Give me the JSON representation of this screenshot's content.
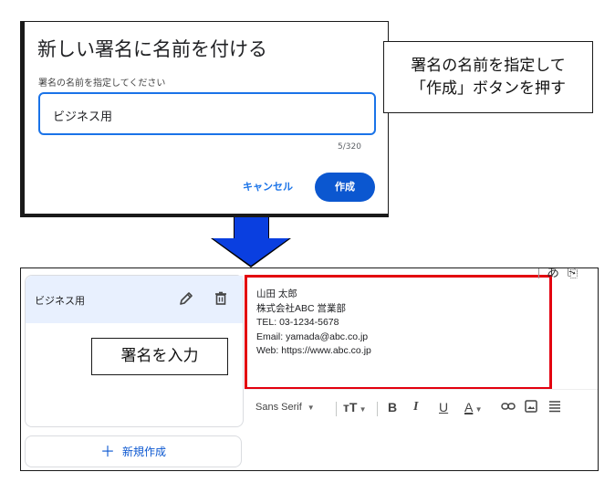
{
  "dialog": {
    "title": "新しい署名に名前を付ける",
    "label": "署名の名前を指定してください",
    "input_value": "ビジネス用",
    "counter": "5/320",
    "cancel_label": "キャンセル",
    "create_label": "作成"
  },
  "callouts": {
    "top_line1": "署名の名前を指定して",
    "top_line2": "「作成」ボタンを押す",
    "bottom": "署名を入力"
  },
  "signatures": {
    "items": [
      {
        "label": "ビジネス用",
        "selected": true
      }
    ],
    "new_button_label": "新規作成"
  },
  "editor": {
    "lines": [
      "山田 太郎",
      "株式会社ABC 営業部",
      "TEL: 03-1234-5678",
      "Email: yamada@abc.co.jp",
      "Web: https://www.abc.co.jp"
    ],
    "highlight_color": "#e3000f"
  },
  "toolbar": {
    "font": "Sans Serif",
    "bold": "B",
    "italic": "I",
    "underline": "U",
    "text_color": "A"
  },
  "colors": {
    "accent": "#1a73e8",
    "primary_button": "#0b57d0",
    "arrow": "#0a3fe0"
  }
}
